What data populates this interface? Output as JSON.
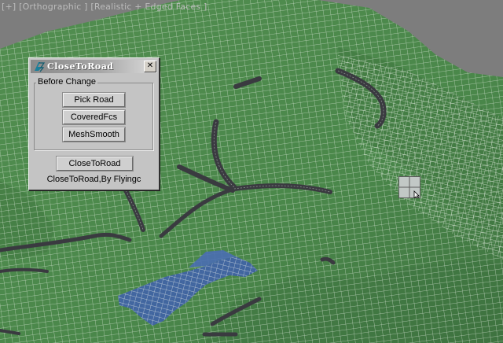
{
  "viewport": {
    "label": "[+] [Orthographic ] [Realistic + Edged Faces ]",
    "colors": {
      "background": "#7d7d7d",
      "terrain": "#4f8a4e",
      "terrain_dark": "#3b6c3b",
      "wire": "#e6efe4",
      "road": "#3d3d43",
      "water": "#4063a6"
    }
  },
  "panel": {
    "title": "CloseToRoad",
    "icon": "maxscript-icon",
    "close_glyph": "✕",
    "group_label": "Before Change",
    "buttons": {
      "pick_road": "Pick Road",
      "covered_fcs": "CoveredFcs",
      "mesh_smooth": "MeshSmooth",
      "close_to_road": "CloseToRoad"
    },
    "footer": "CloseToRoad,By Flyingc"
  },
  "cursor": {
    "icon": "move-cursor-icon"
  }
}
